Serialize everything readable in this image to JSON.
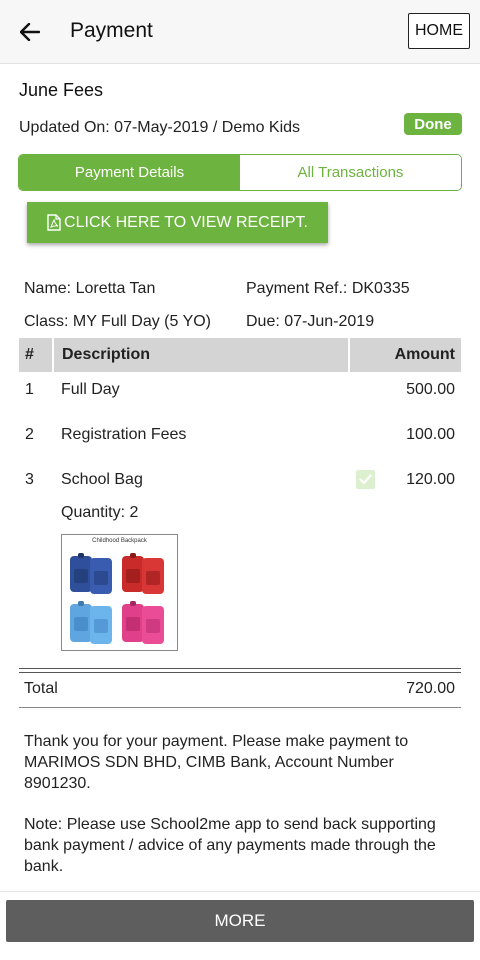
{
  "header": {
    "back_icon": "arrow-left-icon",
    "title": "Payment",
    "home_label": "HOME"
  },
  "fee": {
    "title": "June Fees",
    "updated": "Updated On: 07-May-2019 / Demo Kids",
    "status": "Done",
    "status_color": "#6db33f"
  },
  "tabs": [
    {
      "label": "Payment Details",
      "active": true
    },
    {
      "label": "All Transactions",
      "active": false
    }
  ],
  "receipt_button": {
    "icon": "pdf-file-icon",
    "label": "CLICK HERE TO VIEW RECEIPT."
  },
  "details": {
    "name": "Name: Loretta Tan",
    "payment_ref": "Payment Ref.: DK0335",
    "class": "Class: MY Full Day (5 YO)",
    "due": "Due: 07-Jun-2019"
  },
  "table": {
    "headers": [
      "#",
      "Description",
      "Amount"
    ],
    "rows": [
      {
        "num": "1",
        "description": "Full Day",
        "amount": "500.00"
      },
      {
        "num": "2",
        "description": "Registration Fees",
        "amount": "100.00"
      },
      {
        "num": "3",
        "description": "School Bag",
        "amount": "120.00",
        "quantity": "Quantity: 2",
        "checked": true
      }
    ],
    "product_caption": "Childhood Backpack",
    "total_label": "Total",
    "total_amount": "720.00"
  },
  "notes": {
    "thanks": "Thank you for your payment. Please make payment to MARIMOS SDN BHD, CIMB Bank, Account Number 8901230.",
    "note": "Note: Please use School2me app to send back supporting bank payment / advice of any payments made through the bank."
  },
  "more_label": "MORE",
  "colors": {
    "accent": "#6db33f",
    "table_header_bg": "#d4d4d4",
    "more_button_bg": "#5e5e5e"
  }
}
